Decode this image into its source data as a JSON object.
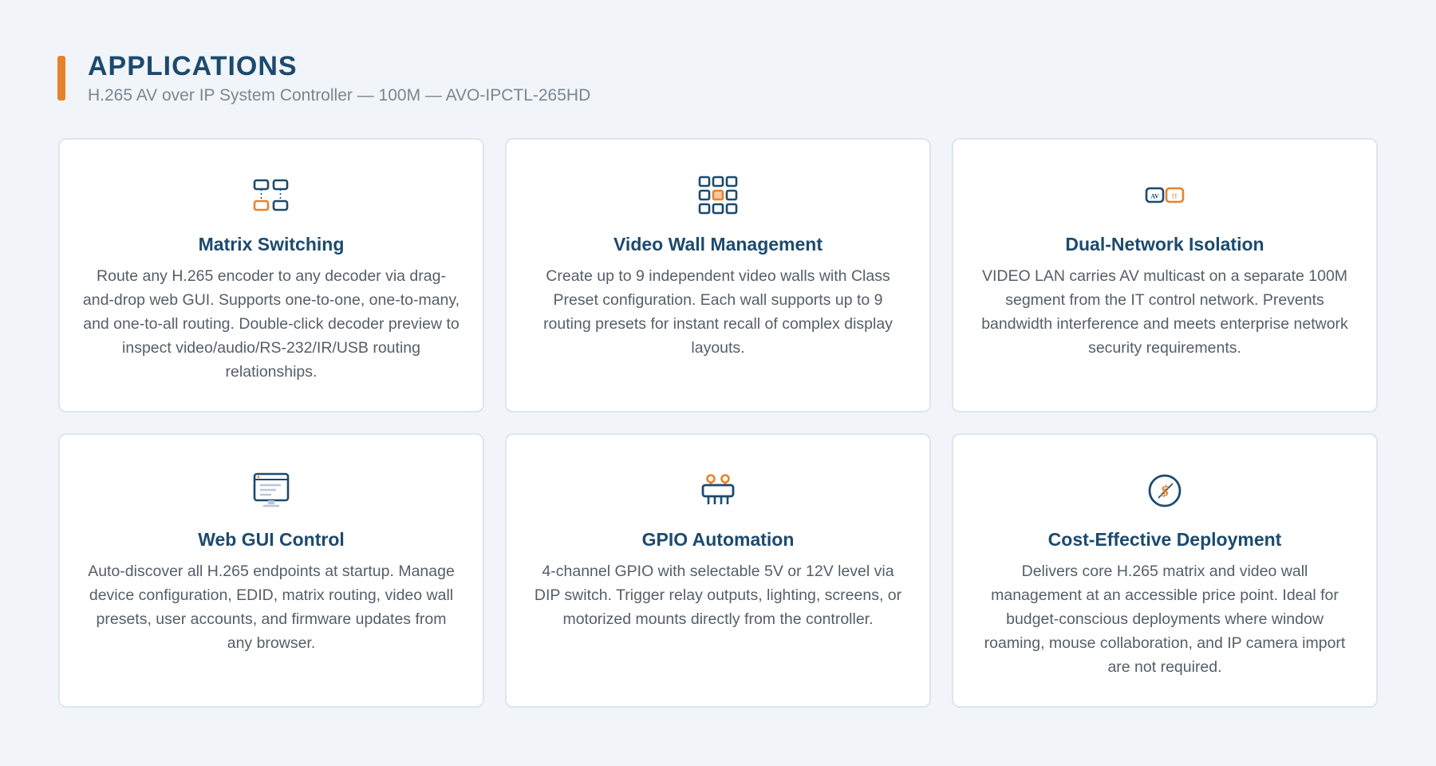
{
  "header": {
    "title": "APPLICATIONS",
    "subtitle": "H.265 AV over IP System Controller — 100M — AVO-IPCTL-265HD"
  },
  "colors": {
    "accent": "#e8822a",
    "primary": "#1c4a6e",
    "background": "#f1f5f9",
    "text": "#555e68"
  },
  "cards": [
    {
      "icon": "matrix-switching-icon",
      "title": "Matrix Switching",
      "description": "Route any H.265 encoder to any decoder via drag-and-drop web GUI. Supports one-to-one, one-to-many, and one-to-all routing. Double-click decoder preview to inspect video/audio/RS-232/IR/USB routing relationships."
    },
    {
      "icon": "video-wall-grid-icon",
      "title": "Video Wall Management",
      "description": "Create up to 9 independent video walls with Class Preset configuration. Each wall supports up to 9 routing presets for instant recall of complex display layouts."
    },
    {
      "icon": "av-it-network-icon",
      "title": "Dual-Network Isolation",
      "description": "VIDEO LAN carries AV multicast on a separate 100M segment from the IT control network. Prevents bandwidth interference and meets enterprise network security requirements.",
      "icon_labels": [
        "AV",
        "IT"
      ]
    },
    {
      "icon": "web-browser-monitor-icon",
      "title": "Web GUI Control",
      "description": "Auto-discover all H.265 endpoints at startup. Manage device configuration, EDID, matrix routing, video wall presets, user accounts, and firmware updates from any browser."
    },
    {
      "icon": "gpio-connector-icon",
      "title": "GPIO Automation",
      "description": "4-channel GPIO with selectable 5V or 12V level via DIP switch. Trigger relay outputs, lighting, screens, or motorized mounts directly from the controller."
    },
    {
      "icon": "cost-dollar-icon",
      "title": "Cost-Effective Deployment",
      "description": "Delivers core H.265 matrix and video wall management at an accessible price point. Ideal for budget-conscious deployments where window roaming, mouse collaboration, and IP camera import are not required.",
      "icon_labels": [
        "$"
      ]
    }
  ]
}
